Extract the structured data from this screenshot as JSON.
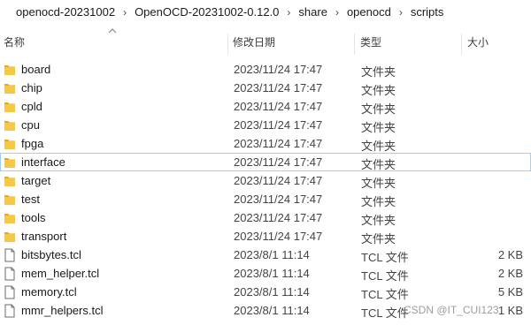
{
  "breadcrumb": [
    "openocd-20231002",
    "OpenOCD-20231002-0.12.0",
    "share",
    "openocd",
    "scripts"
  ],
  "columns": {
    "name": "名称",
    "modified": "修改日期",
    "type": "类型",
    "size": "大小"
  },
  "rows": [
    {
      "name": "board",
      "modified": "2023/11/24 17:47",
      "type": "文件夹",
      "size": "",
      "kind": "folder"
    },
    {
      "name": "chip",
      "modified": "2023/11/24 17:47",
      "type": "文件夹",
      "size": "",
      "kind": "folder"
    },
    {
      "name": "cpld",
      "modified": "2023/11/24 17:47",
      "type": "文件夹",
      "size": "",
      "kind": "folder"
    },
    {
      "name": "cpu",
      "modified": "2023/11/24 17:47",
      "type": "文件夹",
      "size": "",
      "kind": "folder"
    },
    {
      "name": "fpga",
      "modified": "2023/11/24 17:47",
      "type": "文件夹",
      "size": "",
      "kind": "folder"
    },
    {
      "name": "interface",
      "modified": "2023/11/24 17:47",
      "type": "文件夹",
      "size": "",
      "kind": "folder",
      "selected": true
    },
    {
      "name": "target",
      "modified": "2023/11/24 17:47",
      "type": "文件夹",
      "size": "",
      "kind": "folder"
    },
    {
      "name": "test",
      "modified": "2023/11/24 17:47",
      "type": "文件夹",
      "size": "",
      "kind": "folder"
    },
    {
      "name": "tools",
      "modified": "2023/11/24 17:47",
      "type": "文件夹",
      "size": "",
      "kind": "folder"
    },
    {
      "name": "transport",
      "modified": "2023/11/24 17:47",
      "type": "文件夹",
      "size": "",
      "kind": "folder"
    },
    {
      "name": "bitsbytes.tcl",
      "modified": "2023/8/1 11:14",
      "type": "TCL 文件",
      "size": "2 KB",
      "kind": "file"
    },
    {
      "name": "mem_helper.tcl",
      "modified": "2023/8/1 11:14",
      "type": "TCL 文件",
      "size": "2 KB",
      "kind": "file"
    },
    {
      "name": "memory.tcl",
      "modified": "2023/8/1 11:14",
      "type": "TCL 文件",
      "size": "5 KB",
      "kind": "file"
    },
    {
      "name": "mmr_helpers.tcl",
      "modified": "2023/8/1 11:14",
      "type": "TCL 文件",
      "size": "1 KB",
      "kind": "file"
    }
  ],
  "icons": {
    "folder": "folder-icon",
    "file": "file-icon",
    "sort": "sort-up-icon",
    "separator": "chevron-right-icon"
  },
  "colors": {
    "folder": "#f7c844",
    "folder_dark": "#e5aa1a",
    "selection_border": "#99d1ff"
  },
  "watermark": "CSDN @IT_CUI123"
}
